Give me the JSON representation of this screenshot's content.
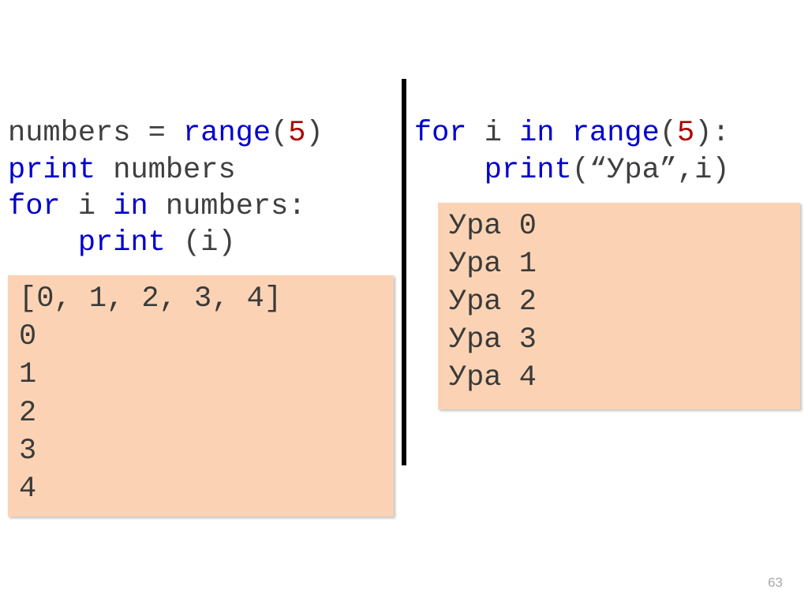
{
  "left": {
    "code": {
      "line1": {
        "a": "numbers = ",
        "kw": "range",
        "b": "(",
        "num": "5",
        "c": ")"
      },
      "line2": {
        "kw": "print",
        "b": " numbers"
      },
      "line3": {
        "kw1": "for",
        "mid": " i ",
        "kw2": "in",
        "b": " numbers:"
      },
      "line4": {
        "indent": "    ",
        "kw": "print",
        "b": " (i)"
      }
    },
    "output": "[0, 1, 2, 3, 4]\n0\n1\n2\n3\n4"
  },
  "right": {
    "code": {
      "line1": {
        "kw1": "for",
        "mid": " i ",
        "kw2": "in",
        "b1": " ",
        "kw3": "range",
        "b2": "(",
        "num": "5",
        "b3": "):"
      },
      "line2": {
        "indent": "    ",
        "kw": "print",
        "b": "(“Ура”,i)"
      }
    },
    "output": "Ура 0\nУра 1\nУра 2\nУра 3\nУра 4"
  },
  "slide_number": "63"
}
